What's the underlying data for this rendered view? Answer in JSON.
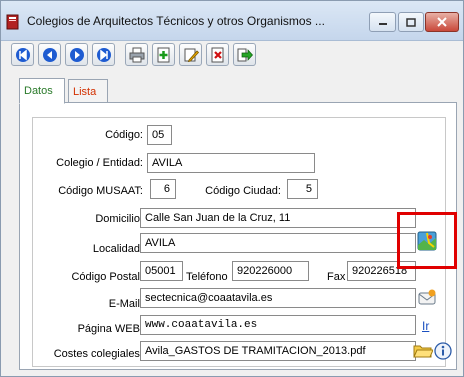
{
  "window": {
    "title": "Colegios de Arquitectos Técnicos y otros Organismos ...",
    "app_icon": "book-icon",
    "controls": {
      "minimize": "minimize-icon",
      "maximize": "maximize-icon",
      "close": "close-icon"
    }
  },
  "toolbar": {
    "buttons": [
      {
        "name": "first-record-icon"
      },
      {
        "name": "previous-record-icon"
      },
      {
        "name": "next-record-icon"
      },
      {
        "name": "last-record-icon"
      },
      {
        "name": "print-icon"
      },
      {
        "name": "add-record-icon"
      },
      {
        "name": "edit-record-icon"
      },
      {
        "name": "delete-record-icon"
      },
      {
        "name": "exit-icon"
      }
    ]
  },
  "tabs": {
    "datos": "Datos",
    "lista": "Lista"
  },
  "form": {
    "codigo": {
      "label": "Código:",
      "value": "05"
    },
    "colegio": {
      "label": "Colegio / Entidad:",
      "value": "AVILA"
    },
    "musaat": {
      "label": "Código MUSAAT:",
      "value": "6"
    },
    "ciudad": {
      "label": "Código Ciudad:",
      "value": "5"
    },
    "domicilio": {
      "label": "Domicilio:",
      "value": "Calle San Juan de la Cruz, 11"
    },
    "localidad": {
      "label": "Localidad:",
      "value": "AVILA"
    },
    "postal": {
      "label": "Código Postal:",
      "value": "05001"
    },
    "telefono": {
      "label": "Teléfono",
      "value": "920226000"
    },
    "fax": {
      "label": "Fax",
      "value": "920226518"
    },
    "email": {
      "label": "E-Mail:",
      "value": "sectecnica@coaatavila.es"
    },
    "web": {
      "label": "Página WEB:",
      "value": "www.coaatavila.es",
      "link": "Ir"
    },
    "costes": {
      "label": "Costes colegiales:",
      "value": "Avila_GASTOS DE TRAMITACION_2013.pdf"
    }
  },
  "colors": {
    "highlight_box": "#e00000",
    "active_tab_text": "#2a7a2a",
    "inactive_tab_text": "#d33000",
    "link": "#1a4fc0"
  }
}
